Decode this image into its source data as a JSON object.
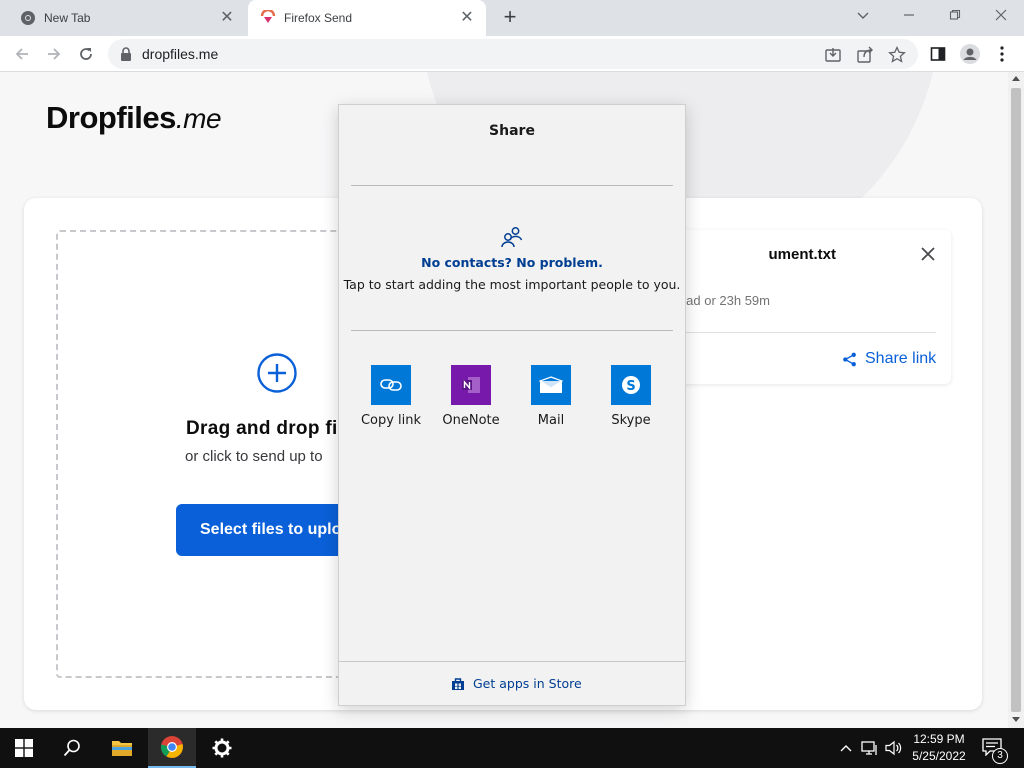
{
  "browser": {
    "tabs": [
      {
        "title": "New Tab",
        "icon": "chrome-icon",
        "active": false
      },
      {
        "title": "Firefox Send",
        "icon": "firefox-send-icon",
        "active": true
      }
    ],
    "url": "dropfiles.me"
  },
  "page": {
    "brand": {
      "name": "Dropfiles",
      "suffix": ".me"
    },
    "dropzone": {
      "title": "Drag and drop fi",
      "subtitle": "or click to send up to",
      "button_label": "Select files to uploa"
    },
    "upload": {
      "file_name": "ument.txt",
      "expiry": "ad or 23h 59m",
      "share_link_label": "Share link"
    }
  },
  "share_flyout": {
    "title": "Share",
    "contacts_heading": "No contacts? No problem.",
    "contacts_hint": "Tap to start adding the most important people to you.",
    "targets": [
      {
        "label": "Copy link",
        "icon": "copy-link-icon",
        "color": "#0078d7"
      },
      {
        "label": "OneNote",
        "icon": "onenote-icon",
        "color": "#7719aa"
      },
      {
        "label": "Mail",
        "icon": "mail-icon",
        "color": "#0078d7"
      },
      {
        "label": "Skype",
        "icon": "skype-icon",
        "color": "#0078d7"
      }
    ],
    "store_link": "Get apps in Store"
  },
  "taskbar": {
    "time": "12:59 PM",
    "date": "5/25/2022",
    "notification_count": "3"
  },
  "colors": {
    "accent": "#0a60d8",
    "windows_accent": "#0078d7",
    "link_dark": "#003e92"
  }
}
